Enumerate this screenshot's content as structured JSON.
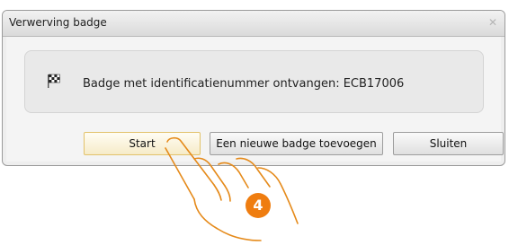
{
  "dialog": {
    "title": "Verwerving badge",
    "message": "Badge met identificatienummer ontvangen: ECB17006",
    "icon": "checkered-flag-icon"
  },
  "buttons": {
    "start": "Start",
    "add": "Een nieuwe badge toevoegen",
    "close": "Sluiten"
  },
  "overlay": {
    "step_number": "4",
    "step_color": "#ef7d10",
    "pointer": "hand-pointer-icon"
  }
}
